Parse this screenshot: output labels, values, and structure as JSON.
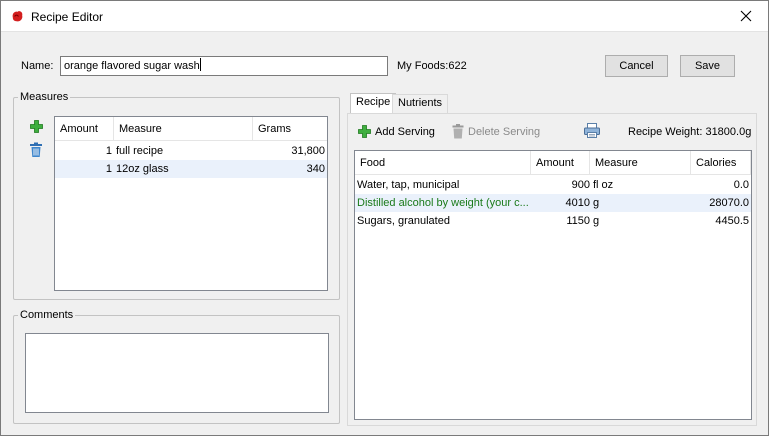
{
  "window": {
    "title": "Recipe Editor"
  },
  "form": {
    "name_label": "Name:",
    "name_value": "orange flavored sugar wash",
    "my_foods": "My Foods:622",
    "cancel_label": "Cancel",
    "save_label": "Save"
  },
  "measures": {
    "legend": "Measures",
    "columns": [
      "Amount",
      "Measure",
      "Grams"
    ],
    "rows": [
      {
        "amount": "1",
        "measure": "full recipe",
        "grams": "31,800"
      },
      {
        "amount": "1",
        "measure": "12oz glass",
        "grams": "340"
      }
    ]
  },
  "comments": {
    "legend": "Comments",
    "value": ""
  },
  "tabs": [
    {
      "label": "Recipe",
      "active": true
    },
    {
      "label": "Nutrients",
      "active": false
    }
  ],
  "recipe": {
    "add_serving": "Add Serving",
    "delete_serving": "Delete Serving",
    "recipe_weight": "Recipe Weight: 31800.0g",
    "columns": [
      "Food",
      "Amount",
      "Measure",
      "Calories"
    ],
    "rows": [
      {
        "food": "Water, tap, municipal",
        "amount": "900",
        "measure": "fl oz",
        "calories": "0.0"
      },
      {
        "food": "Distilled alcohol by weight (your c...",
        "amount": "4010",
        "measure": "g",
        "calories": "28070.0"
      },
      {
        "food": "Sugars, granulated",
        "amount": "1150",
        "measure": "g",
        "calories": "4450.5"
      }
    ]
  },
  "colors": {
    "accent_green": "#1a7a1a",
    "selected_row": "#eaf1fb"
  }
}
